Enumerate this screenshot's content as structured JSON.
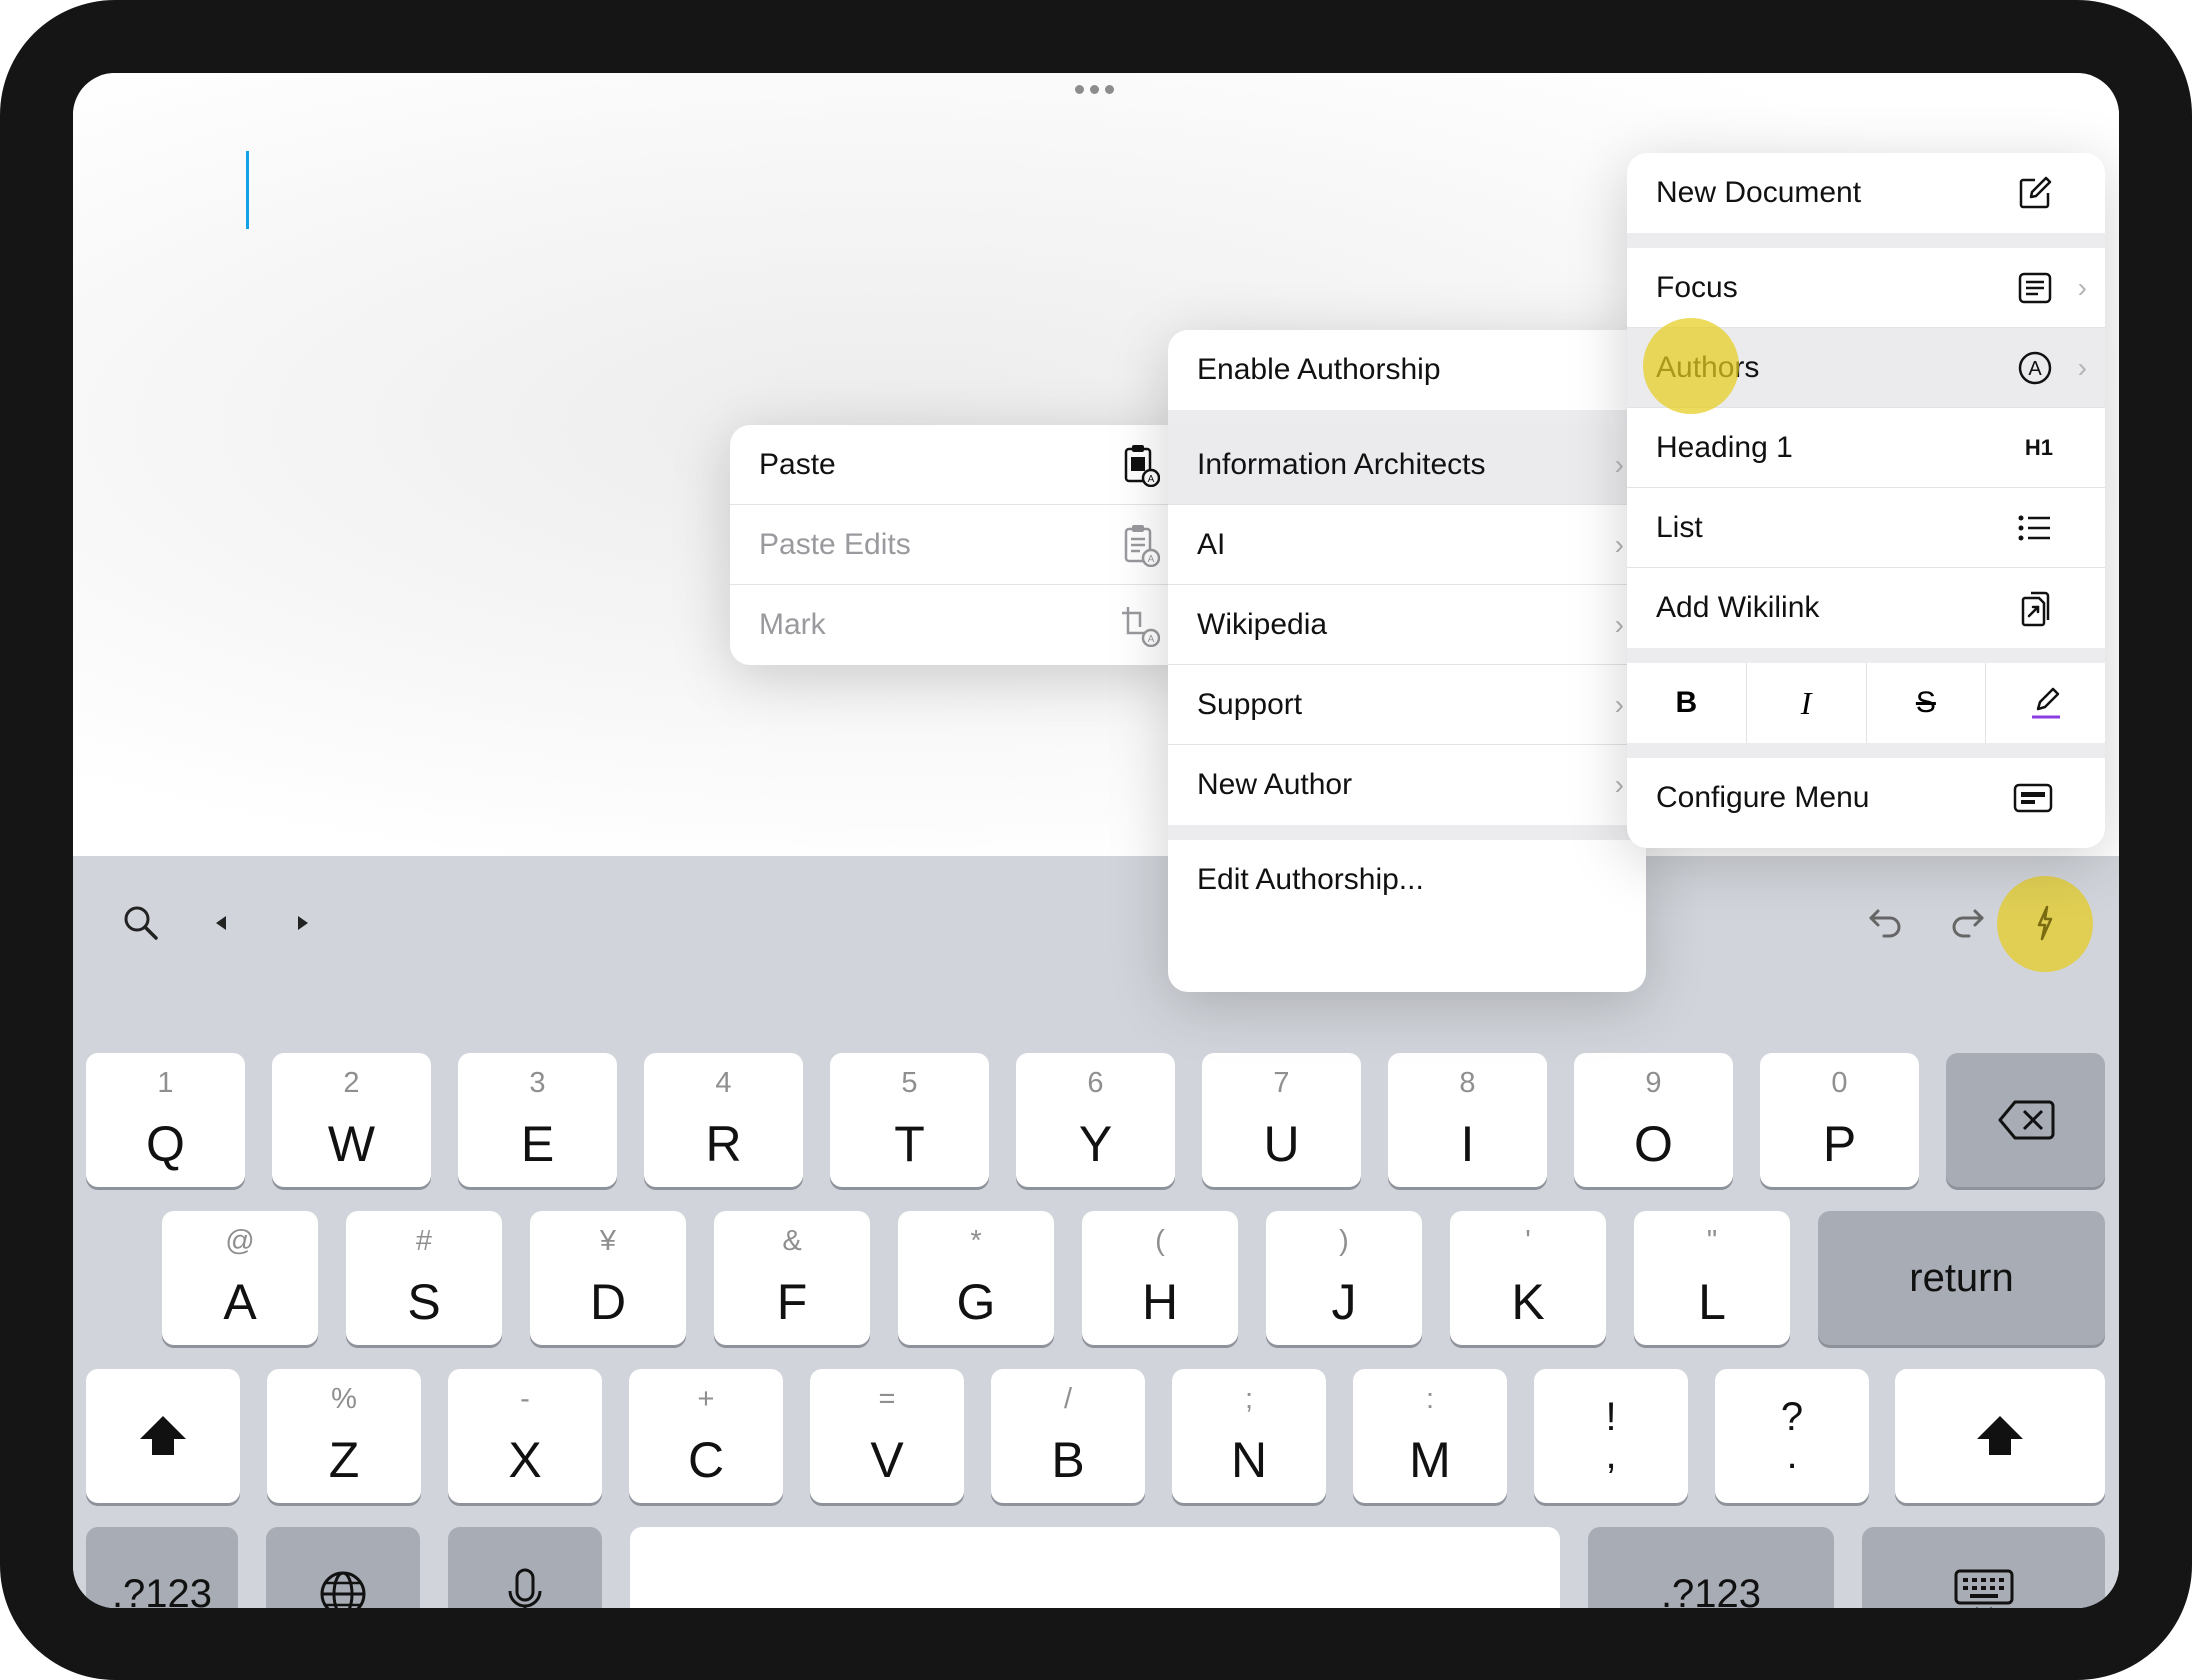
{
  "right_menu": {
    "items": [
      {
        "label": "New Document",
        "icon": "compose-icon"
      },
      {
        "label": "Focus",
        "icon": "focus-icon"
      },
      {
        "label": "Authors",
        "icon": "author-a-icon"
      },
      {
        "label": "Heading 1",
        "icon": "H1"
      },
      {
        "label": "List",
        "icon": "list-icon"
      },
      {
        "label": "Add Wikilink",
        "icon": "wikilink-icon"
      }
    ],
    "format_buttons": [
      "B",
      "I",
      "S"
    ],
    "configure": "Configure Menu"
  },
  "authors_menu": {
    "items": [
      {
        "label": "Enable Authorship"
      },
      {
        "label": "Information Architects"
      },
      {
        "label": "AI"
      },
      {
        "label": "Wikipedia"
      },
      {
        "label": "Support"
      },
      {
        "label": "New Author"
      },
      {
        "label": "Edit Authorship..."
      }
    ]
  },
  "ia_menu": {
    "items": [
      {
        "label": "Paste",
        "enabled": true
      },
      {
        "label": "Paste Edits",
        "enabled": false
      },
      {
        "label": "Mark",
        "enabled": false
      }
    ]
  },
  "keyboard": {
    "row1": [
      {
        "sub": "1",
        "main": "Q"
      },
      {
        "sub": "2",
        "main": "W"
      },
      {
        "sub": "3",
        "main": "E"
      },
      {
        "sub": "4",
        "main": "R"
      },
      {
        "sub": "5",
        "main": "T"
      },
      {
        "sub": "6",
        "main": "Y"
      },
      {
        "sub": "7",
        "main": "U"
      },
      {
        "sub": "8",
        "main": "I"
      },
      {
        "sub": "9",
        "main": "O"
      },
      {
        "sub": "0",
        "main": "P"
      }
    ],
    "row2": [
      {
        "sub": "@",
        "main": "A"
      },
      {
        "sub": "#",
        "main": "S"
      },
      {
        "sub": "¥",
        "main": "D"
      },
      {
        "sub": "&",
        "main": "F"
      },
      {
        "sub": "*",
        "main": "G"
      },
      {
        "sub": "(",
        "main": "H"
      },
      {
        "sub": ")",
        "main": "J"
      },
      {
        "sub": "'",
        "main": "K"
      },
      {
        "sub": "\"",
        "main": "L"
      }
    ],
    "row3": [
      {
        "sub": "%",
        "main": "Z"
      },
      {
        "sub": "-",
        "main": "X"
      },
      {
        "sub": "+",
        "main": "C"
      },
      {
        "sub": "=",
        "main": "V"
      },
      {
        "sub": "/",
        "main": "B"
      },
      {
        "sub": ";",
        "main": "N"
      },
      {
        "sub": ":",
        "main": "M"
      }
    ],
    "punct": [
      {
        "top": "!",
        "bottom": ","
      },
      {
        "top": "?",
        "bottom": "."
      }
    ],
    "return": "return",
    "numbers_left": ".?123",
    "numbers_right": ".?123"
  }
}
